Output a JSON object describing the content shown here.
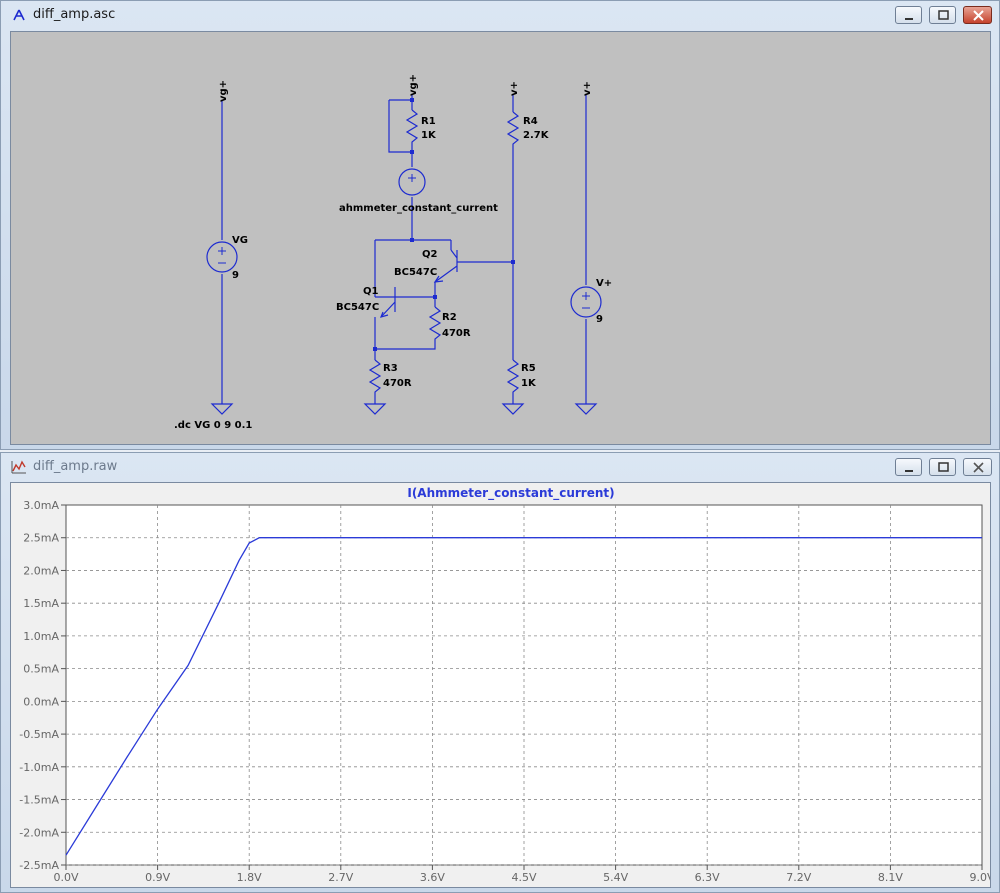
{
  "schematic_window": {
    "title": "diff_amp.asc",
    "icon": "ltspice-schematic-icon",
    "controls": [
      "minimize",
      "maximize",
      "close"
    ]
  },
  "schematic": {
    "labels": {
      "vg_left": "vg+",
      "vg_mid": "vg+",
      "v_r4": "v+",
      "v_right": "v+",
      "r1_name": "R1",
      "r1_value": "1K",
      "r4_name": "R4",
      "r4_value": "2.7K",
      "ammeter": "ahmmeter_constant_current",
      "vg_name": "VG",
      "vg_value": "9",
      "q2_name": "Q2",
      "q2_model": "BC547C",
      "q1_name": "Q1",
      "q1_model": "BC547C",
      "r2_name": "R2",
      "r2_value": "470R",
      "r3_name": "R3",
      "r3_value": "470R",
      "r5_name": "R5",
      "r5_value": "1K",
      "vplus_name": "V+",
      "vplus_value": "9",
      "directive": ".dc VG 0 9 0.1"
    },
    "wire_color": "#1d2bd0"
  },
  "plot_window": {
    "title": "diff_amp.raw",
    "icon": "waveform-icon",
    "controls": [
      "minimize",
      "maximize",
      "close"
    ]
  },
  "chart_data": {
    "type": "line",
    "title": "I(Ahmmeter_constant_current)",
    "xlabel": "",
    "ylabel": "",
    "x_ticks": [
      "0.0V",
      "0.9V",
      "1.8V",
      "2.7V",
      "3.6V",
      "4.5V",
      "5.4V",
      "6.3V",
      "7.2V",
      "8.1V",
      "9.0V"
    ],
    "y_ticks": [
      "3.0mA",
      "2.5mA",
      "2.0mA",
      "1.5mA",
      "1.0mA",
      "0.5mA",
      "0.0mA",
      "-0.5mA",
      "-1.0mA",
      "-1.5mA",
      "-2.0mA",
      "-2.5mA"
    ],
    "xlim": [
      0,
      9
    ],
    "ylim": [
      -2.5,
      3.0
    ],
    "grid": true,
    "series": [
      {
        "name": "I(Ahmmeter_constant_current)",
        "color": "#2b3bd8",
        "x": [
          0.0,
          0.3,
          0.6,
          0.9,
          1.2,
          1.5,
          1.7,
          1.8,
          1.9,
          2.0,
          3.0,
          4.0,
          5.0,
          6.0,
          7.0,
          8.0,
          9.0
        ],
        "y": [
          -2.35,
          -1.6,
          -0.85,
          -0.12,
          0.55,
          1.5,
          2.15,
          2.42,
          2.5,
          2.5,
          2.5,
          2.5,
          2.5,
          2.5,
          2.5,
          2.5,
          2.5
        ]
      }
    ]
  }
}
